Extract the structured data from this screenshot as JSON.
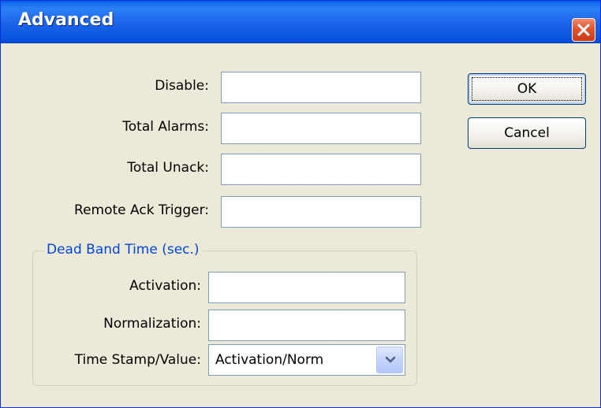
{
  "window": {
    "title": "Advanced"
  },
  "fields": {
    "disable": {
      "label": "Disable:",
      "value": ""
    },
    "total_alarms": {
      "label": "Total Alarms:",
      "value": ""
    },
    "total_unack": {
      "label": "Total Unack:",
      "value": ""
    },
    "remote_ack_trigger": {
      "label": "Remote Ack Trigger:",
      "value": ""
    }
  },
  "buttons": {
    "ok": "OK",
    "cancel": "Cancel"
  },
  "dead_band": {
    "legend": "Dead Band Time (sec.)",
    "activation": {
      "label": "Activation:",
      "value": ""
    },
    "normalization": {
      "label": "Normalization:",
      "value": ""
    },
    "timestamp": {
      "label": "Time Stamp/Value:",
      "selected": "Activation/Norm"
    }
  },
  "colors": {
    "title_bar": "#0a56e0",
    "close_button": "#e1542f",
    "dialog_background": "#ece9d8",
    "group_legend": "#0046d5"
  },
  "icons": {
    "close": "close-icon",
    "dropdown": "chevron-down-icon"
  }
}
